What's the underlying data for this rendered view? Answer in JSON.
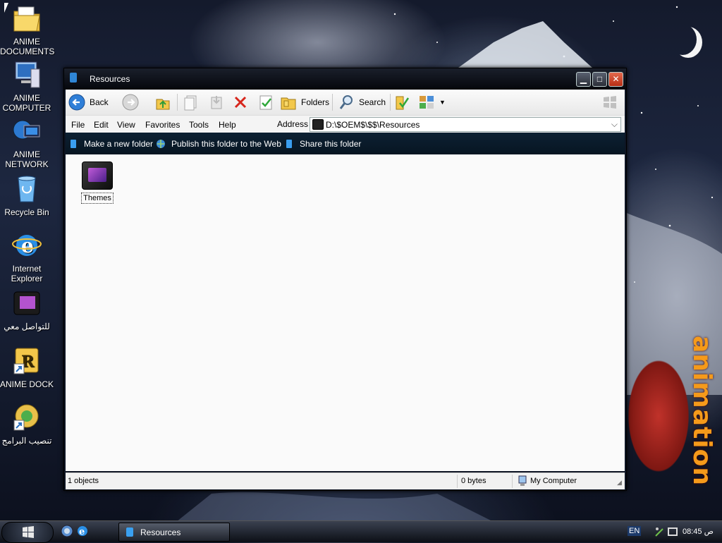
{
  "desktop": {
    "icons": [
      {
        "label": "ANIME DOCUMENTS"
      },
      {
        "label": "ANIME COMPUTER"
      },
      {
        "label": "ANIME NETWORK"
      },
      {
        "label": "Recycle Bin"
      },
      {
        "label": "Internet Explorer"
      },
      {
        "label": "للتواصل معي"
      },
      {
        "label": "ANIME DOCK"
      },
      {
        "label": "تنصيب البرامج"
      }
    ],
    "brand_text": "animation"
  },
  "window": {
    "title": "Resources",
    "controls": {
      "minimize": "▁",
      "maximize": "□",
      "close": "✕"
    },
    "toolbar": {
      "back_label": "Back",
      "folders_label": "Folders",
      "search_label": "Search"
    },
    "menu": [
      "File",
      "Edit",
      "View",
      "Favorites",
      "Tools",
      "Help"
    ],
    "address": {
      "label": "Address",
      "value": "D:\\$OEM$\\$$\\Resources"
    },
    "tasks": [
      "Make a new folder",
      "Publish this folder to the Web",
      "Share this folder"
    ],
    "files": [
      {
        "name": "Themes"
      }
    ],
    "status": {
      "objects": "1 objects",
      "size": "0 bytes",
      "location": "My Computer"
    }
  },
  "taskbar": {
    "button_label": "Resources",
    "language": "EN",
    "clock": "08:45 ص"
  },
  "colors": {
    "accent": "#2f86d6",
    "close": "#c7381c",
    "task_strip": "#0b1d2e"
  }
}
